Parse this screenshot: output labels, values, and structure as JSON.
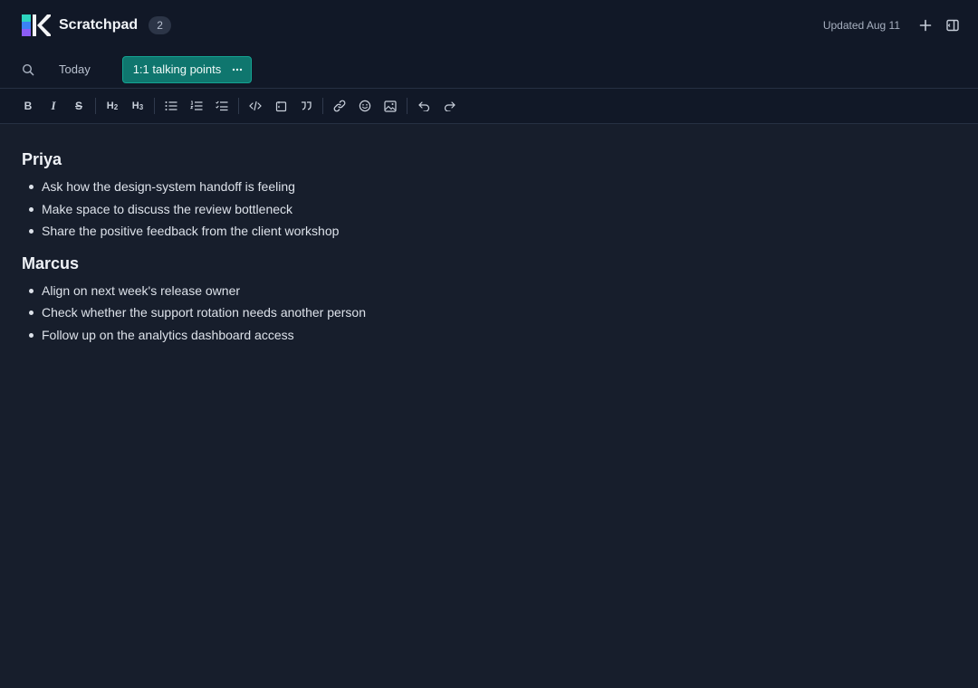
{
  "header": {
    "title": "Scratchpad",
    "note_count": "2",
    "updated": "Updated Aug 11",
    "icons": {
      "logo": "k-logo",
      "new": "plus-icon",
      "sidebar": "sidebar-panel-icon"
    },
    "colors": {
      "logo_teal": "#2dd4bf",
      "logo_blue": "#3b82f6",
      "logo_purple": "#8b5cf6"
    }
  },
  "tabs": {
    "search_icon": "search-icon",
    "items": [
      {
        "label": "Today",
        "active": false
      },
      {
        "label": "1:1 talking points",
        "active": true
      }
    ],
    "active_color": "#0f766e"
  },
  "toolbar": {
    "groups": [
      [
        "bold",
        "italic",
        "strikethrough"
      ],
      [
        "heading-2",
        "heading-3"
      ],
      [
        "bullet-list",
        "numbered-list",
        "checklist"
      ],
      [
        "code",
        "code-block",
        "quote"
      ],
      [
        "link",
        "emoji",
        "image"
      ],
      [
        "undo",
        "redo"
      ]
    ],
    "bold_label": "B",
    "italic_label": "I",
    "strike_label": "S",
    "h2_label": "H",
    "h2_sub": "2",
    "h3_label": "H",
    "h3_sub": "3"
  },
  "note": {
    "sections": [
      {
        "heading": "Priya",
        "items": [
          "Ask how the design-system handoff is feeling",
          "Make space to discuss the review bottleneck",
          "Share the positive feedback from the client workshop"
        ]
      },
      {
        "heading": "Marcus",
        "items": [
          "Align on next week's release owner",
          "Check whether the support rotation needs another person",
          "Follow up on the analytics dashboard access"
        ]
      }
    ]
  }
}
